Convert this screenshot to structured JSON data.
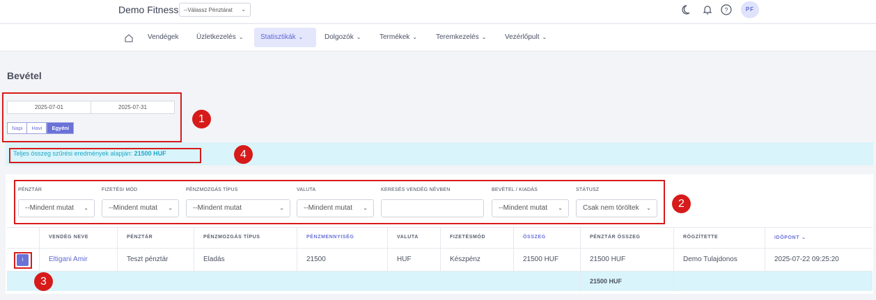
{
  "header": {
    "brand": "Demo Fitness",
    "register_select": "--Válassz Pénztárat",
    "avatar": "PF",
    "icons": [
      "moon-icon",
      "bell-icon",
      "help-icon"
    ]
  },
  "nav": {
    "items": [
      {
        "label": "Vendégek"
      },
      {
        "label": "Üzletkezelés"
      },
      {
        "label": "Statisztikák"
      },
      {
        "label": "Dolgozók"
      },
      {
        "label": "Termékek"
      },
      {
        "label": "Teremkezelés"
      },
      {
        "label": "Vezérlőpult"
      }
    ],
    "active": "Statisztikák"
  },
  "page": {
    "title": "Bevétel",
    "date_from": "2025-07-01",
    "date_to": "2025-07-31",
    "periods": [
      "Napi",
      "Havi",
      "Egyéni"
    ],
    "active_period": "Egyéni",
    "total_label": "Teljes összeg szűrési eredmények alapján:",
    "total_value": "21500 HUF"
  },
  "filters": [
    {
      "label": "PÉNZTÁR",
      "value": "--Mindent mutat"
    },
    {
      "label": "FIZETÉSI MÓD",
      "value": "--Mindent mutat"
    },
    {
      "label": "PÉNZMOZGÁS TÍPUS",
      "value": "--Mindent mutat"
    },
    {
      "label": "VALUTA",
      "value": "--Mindent mutat"
    },
    {
      "label": "KERESÉS VENDÉG NÉVBEN",
      "value": ""
    },
    {
      "label": "BEVÉTEL / KIADÁS",
      "value": "--Mindent mutat"
    },
    {
      "label": "STÁTUSZ",
      "value": "Csak nem töröltek"
    }
  ],
  "table": {
    "headers": [
      "VENDÉG NEVE",
      "PÉNZTÁR",
      "PÉNZMOZGÁS TÍPUS",
      "PÉNZMENNYISÉG",
      "VALUTA",
      "FIZETÉSMÓD",
      "ÖSSZEG",
      "PÉNZTÁR ÖSSZEG",
      "RÖGZÍTETTE",
      "IDŐPONT"
    ],
    "rows": [
      {
        "action": "I",
        "cells": [
          "Eltigani Amir",
          "Teszt pénztár",
          "Eladás",
          "21500",
          "HUF",
          "Készpénz",
          "21500 HUF",
          "21500 HUF",
          "Demo Tulajdonos",
          "2025-07-22 09:25:20"
        ]
      }
    ],
    "summary": "21500 HUF"
  },
  "annotations": [
    "1",
    "2",
    "3",
    "4"
  ],
  "colors": {
    "accent": "#6a72d8",
    "annotation": "#d71a1a",
    "info_bg": "#d9f4fa",
    "info_text": "#1fa7c6"
  }
}
